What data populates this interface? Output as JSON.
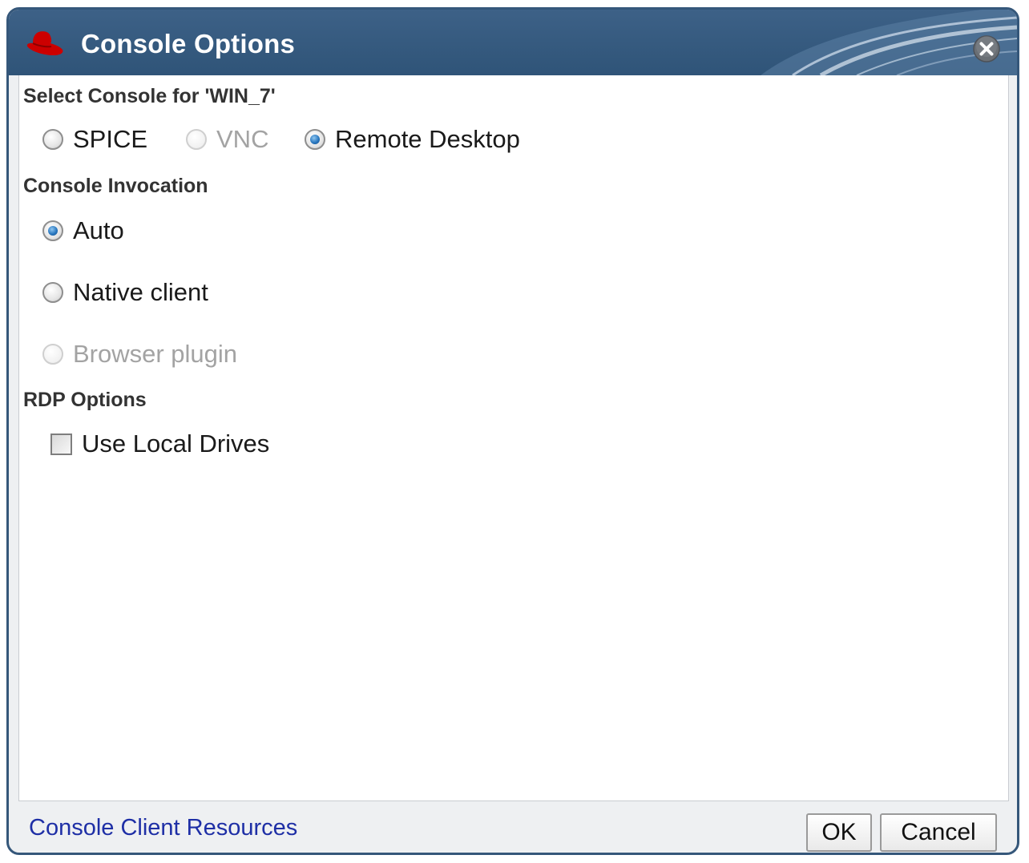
{
  "dialog": {
    "title": "Console Options",
    "logo_icon": "redhat-logo",
    "close_icon": "close-icon"
  },
  "console_selection": {
    "label": "Select Console for 'WIN_7'",
    "options": [
      {
        "label": "SPICE",
        "checked": false,
        "disabled": false
      },
      {
        "label": "VNC",
        "checked": false,
        "disabled": true
      },
      {
        "label": "Remote Desktop",
        "checked": true,
        "disabled": false
      }
    ]
  },
  "console_invocation": {
    "label": "Console Invocation",
    "options": [
      {
        "label": "Auto",
        "checked": true,
        "disabled": false
      },
      {
        "label": "Native client",
        "checked": false,
        "disabled": false
      },
      {
        "label": "Browser plugin",
        "checked": false,
        "disabled": true
      }
    ]
  },
  "rdp_options": {
    "label": "RDP Options",
    "use_local_drives": {
      "label": "Use Local Drives",
      "checked": false
    }
  },
  "footer": {
    "resources_link": "Console Client Resources",
    "ok_label": "OK",
    "cancel_label": "Cancel"
  },
  "colors": {
    "titlebar": "#35577a",
    "link": "#1e2fa6",
    "logo_red": "#cc0000"
  }
}
